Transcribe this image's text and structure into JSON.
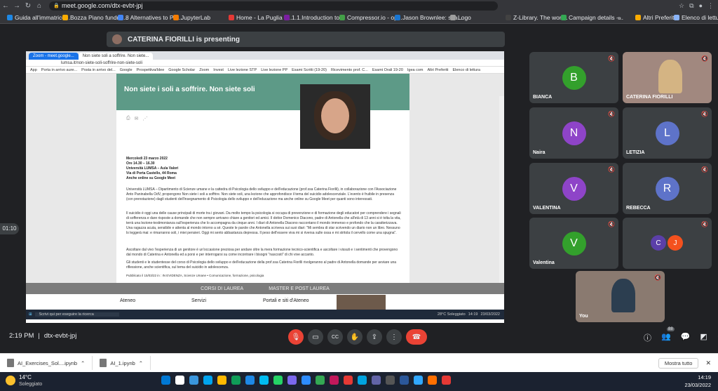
{
  "browser": {
    "url": "meet.google.com/dtx-evbt-jpj",
    "bookmarks": [
      "Guida all'immatrico...",
      "Bozza Piano fundrai...",
      "8 Alternatives to Pa...",
      "JupyterLab",
      "Home - La Puglia ti...",
      "1.1.Introduction to...",
      "Compressor.io - op...",
      "Jason Brownlee: sca...",
      "Logo",
      "Z-Library. The worl...",
      "Campaign details -..."
    ],
    "bookmark_colors": [
      "#1e88e5",
      "#f9ab00",
      "#4285f4",
      "#f57c00",
      "#e53935",
      "#7b1fa2",
      "#43a047",
      "#1976d2",
      "#9e9e9e",
      "#424242",
      "#34a853"
    ],
    "more": "»",
    "other_favorites": "Altri Preferiti",
    "reading_list": "Elenco di lettura"
  },
  "presenting": {
    "text": "CATERINA FIORILLI is presenting"
  },
  "shared_screen": {
    "tabs": [
      "Zoom - meet.google...",
      "Non siete soli a soffrire. Non siete..."
    ],
    "url": "lumsa.it/non-siete-soli-soffrire-non-siete-soli",
    "bookmarks": [
      "App",
      "Porta in arrivo aure...",
      "Posta in arrivo del...",
      "Google",
      "Prospettiva/Idee",
      "Google Scholar",
      "Zoom",
      "Invest",
      "Live lezione STP",
      "Live lezione PP",
      "Esami Scritti (19-20)",
      "Ricevimento prof. C...",
      "Esami Orali 19-20",
      "Igea com",
      "Altri Preferiti",
      "Elenco di lettura"
    ],
    "article": {
      "title": "Non siete i soli a soffrire. Non siete soli",
      "event_lines": [
        "Mercoledì 23 marzo 2022",
        "Ore 14.30 – 16.30",
        "Università LUMSA – Aula Valori",
        "Via di Porta Castello, 44 Roma",
        "Anche online su Google Meet"
      ],
      "p1": "Università LUMSA – Dipartimento di Scienze umane e la cattedra di Psicologia dello sviluppo e dell'educazione (prof.ssa Caterina Fiorilli), in collaborazione con l'Associazione Anto Paninabella OdV, propongono Non siete i soli a soffrire. Non siete soli, una lezione che approfondisce il tema del suicidio adolescenziale. L'evento è fruibile in presenza (con prenotazione) dagli studenti dell'insegnamento di Psicologia dello sviluppo e dell'educazione ma anche online su Google Meet per quanti sono interessati.",
      "p2": "Il suicidio è oggi una delle cause principali di morte tra i giovani. Da molto tempo la psicologia si occupa di prevenzione e di formazione degli educatori per comprendere i segnali di sofferenza e dare risposte a domande che non sempre arrivano chiare a genitori ed amici. Il dottor Domenico Diacono, padre di Antonella che all'età di 13 anni si è tolta la vita, terrà una lezione-testimonianza sull'esperienza che lo accompagna da cinque anni. I diari di Antonella Diacono raccontano il mondo immenso e profondo che la caratterizzava. Una ragazza acuta, sensibile e attenta al mondo intorno a sé. Queste le parole che Antonella scriveva sui suoi diari: \"Mi sembra di star scrivendo un diario non un libro. Nessuno lo leggerà mai: e rimarranno soli, i miei pensieri. Oggi mi sento abbastanza depressa. Il peso dell'essere viva mi si riversa sulle ossa e mi stritola il cervello come una spugna\".",
      "p3": "Ascoltare dal vivo l'esperienza di un genitore è un'occasione preziosa per andare oltre la mera formazione tecnico-scientifica e ascoltare i vissuti e i sentimenti che provengono dal mondo di Caterina e Antonella ed a porsi e per interrogarsi su come incontrare i bisogni \"nascosti\" di chi vive accanto.",
      "p4": "Gli studenti e le studentesse del corso di Psicologia dello sviluppo e dell'educazione della prof.ssa Caterina Fiorilli rivolgeranno al padre di Antonella domande per avviare una riflessione, anche scientifica, sul tema del suicidio in adolescenza.",
      "published": "Pubblicato il 15/03/22 in : IN EVIDENZA, Scienze Umane • Comunicazione, formazione, psicologia"
    },
    "nav_band": [
      "CORSI DI LAUREA",
      "MASTER E POST LAUREA"
    ],
    "footer": [
      "Ateneo",
      "Servizi",
      "Portali e siti d'Ateneo"
    ],
    "taskbar_search": "Scrivi qui per eseguire la ricerca",
    "taskbar_weather": "28°C Soleggiato",
    "taskbar_time": "14:19",
    "taskbar_date": "23/03/2022"
  },
  "participants": [
    {
      "name": "BIANCA",
      "initial": "B",
      "color": "#33a02c"
    },
    {
      "name": "CATERINA FIORILLI",
      "initial": "",
      "color": "#a1887f"
    },
    {
      "name": "Naira",
      "initial": "N",
      "color": "#8e44c8"
    },
    {
      "name": "LETIZIA",
      "initial": "L",
      "color": "#5e73c9"
    },
    {
      "name": "VALENTINA",
      "initial": "V",
      "color": "#8e44c8"
    },
    {
      "name": "REBECCA",
      "initial": "R",
      "color": "#5e73c9"
    },
    {
      "name": "Valentina",
      "initial": "V",
      "color": "#33a02c"
    },
    {
      "name": "",
      "initial": "C",
      "initial2": "J",
      "color": "#5b3fa8",
      "color2": "#f4511e"
    },
    {
      "name": "You",
      "initial": "",
      "color": "#5d4037"
    }
  ],
  "side_timer": "01:10",
  "meeting": {
    "time": "2:19 PM",
    "code": "dtx-evbt-jpj",
    "participant_count": "88"
  },
  "controls": [
    "mic-off-icon",
    "camera-icon",
    "captions-icon",
    "raise-hand-icon",
    "present-icon",
    "more-icon",
    "end-call-icon"
  ],
  "downloads": [
    {
      "name": "AI_Exercises_Sol....ipynb"
    },
    {
      "name": "AI_1.ipynb"
    }
  ],
  "show_all": "Mostra tutto",
  "windows": {
    "weather_temp": "14°C",
    "weather_desc": "Soleggiato",
    "time": "14:19",
    "date": "23/03/2022"
  }
}
